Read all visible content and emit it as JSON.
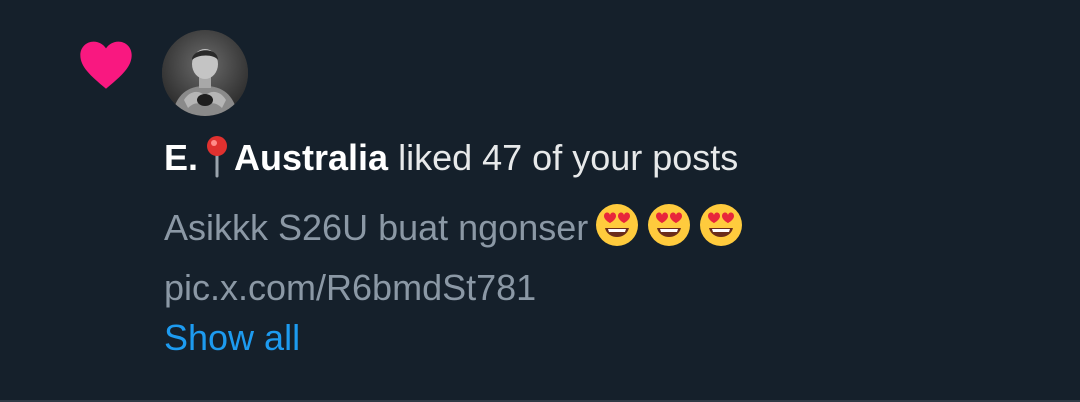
{
  "notification": {
    "user_name": "E.",
    "user_location": "Australia",
    "action_text": " liked 47 of your posts",
    "post_text": "Asikkk S26U buat ngonser",
    "post_link": "pic.x.com/R6bmdSt781",
    "show_all_label": "Show all",
    "icons": {
      "like": "heart-icon",
      "location": "round-pushpin-icon",
      "emoji": "smiling-face-with-heart-eyes-icon"
    },
    "colors": {
      "background": "#15202b",
      "heart": "#f91880",
      "link": "#1d9bf0",
      "primary_text": "#e7e9ea",
      "secondary_text": "#8b98a5"
    }
  }
}
